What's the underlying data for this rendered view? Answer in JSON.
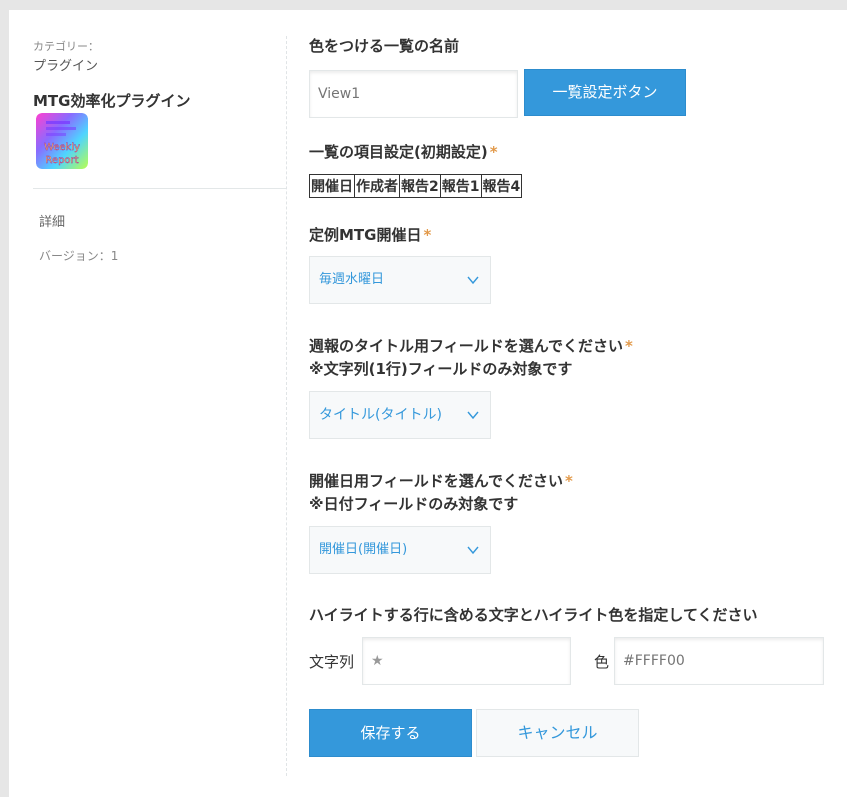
{
  "sidebar": {
    "category_label": "カテゴリー：",
    "category_value": "プラグイン",
    "plugin_name": "MTG効率化プラグイン",
    "icon_text_line1": "Weekly",
    "icon_text_line2": "Report",
    "detail_link": "詳細",
    "version": "バージョン：1"
  },
  "view_section": {
    "label": "色をつける一覧の名前",
    "input_placeholder": "View1",
    "button_label": "一覧設定ボタン"
  },
  "columns_section": {
    "label": "一覧の項目設定(初期設定)",
    "required_mark": "*",
    "columns": [
      "開催日",
      "作成者",
      "報告2",
      "報告1",
      "報告4"
    ]
  },
  "meeting_day": {
    "label": "定例MTG開催日",
    "required_mark": "*",
    "selected": "毎週水曜日"
  },
  "title_field": {
    "label_line1": "週報のタイトル用フィールドを選んでください",
    "label_line2": "※文字列(1行)フィールドのみ対象です",
    "required_mark": "*",
    "selected": "タイトル(タイトル)"
  },
  "date_field": {
    "label_line1": "開催日用フィールドを選んでください",
    "label_line2": "※日付フィールドのみ対象です",
    "required_mark": "*",
    "selected": "開催日(開催日)"
  },
  "highlight": {
    "label": "ハイライトする行に含める文字とハイライト色を指定してください",
    "text_label": "文字列",
    "text_value": "★",
    "color_label": "色",
    "color_placeholder": "#FFFF00"
  },
  "actions": {
    "save": "保存する",
    "cancel": "キャンセル"
  },
  "colors": {
    "accent": "#3498db",
    "required": "#e29a4b",
    "background": "#e6e6e6"
  }
}
